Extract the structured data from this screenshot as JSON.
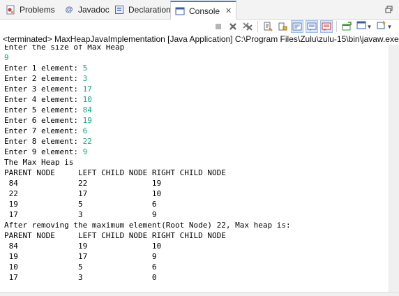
{
  "tabs": [
    {
      "label": "Problems",
      "icon": "problems-icon"
    },
    {
      "label": "Javadoc",
      "icon": "at-icon"
    },
    {
      "label": "Declaration",
      "icon": "declaration-icon"
    },
    {
      "label": "Console",
      "icon": "console-icon",
      "close": "✕"
    }
  ],
  "status": "<terminated> MaxHeapJavaImplementation [Java Application] C:\\Program Files\\Zulu\\zulu-15\\bin\\javaw.exe",
  "console": {
    "lines": [
      {
        "text": "Enter the size of Max Heap"
      },
      {
        "input": "9"
      },
      {
        "text": "Enter 1 element: ",
        "input": "5"
      },
      {
        "text": "Enter 2 element: ",
        "input": "3"
      },
      {
        "text": "Enter 3 element: ",
        "input": "17"
      },
      {
        "text": "Enter 4 element: ",
        "input": "10"
      },
      {
        "text": "Enter 5 element: ",
        "input": "84"
      },
      {
        "text": "Enter 6 element: ",
        "input": "19"
      },
      {
        "text": "Enter 7 element: ",
        "input": "6"
      },
      {
        "text": "Enter 8 element: ",
        "input": "22"
      },
      {
        "text": "Enter 9 element: ",
        "input": "9"
      },
      {
        "text": "The Max Heap is"
      },
      {
        "text": "PARENT NODE     LEFT CHILD NODE RIGHT CHILD NODE"
      },
      {
        "text": " 84             22              19"
      },
      {
        "text": " 22             17              10"
      },
      {
        "text": " 19             5               6"
      },
      {
        "text": " 17             3               9"
      },
      {
        "text": "After removing the maximum element(Root Node) 22, Max heap is:"
      },
      {
        "text": "PARENT NODE     LEFT CHILD NODE RIGHT CHILD NODE"
      },
      {
        "text": " 84             19              10"
      },
      {
        "text": " 19             17              9"
      },
      {
        "text": " 10             5               6"
      },
      {
        "text": " 17             3               0"
      }
    ]
  },
  "colors": {
    "input": "#1aa584",
    "accent": "#3d7dd6"
  }
}
